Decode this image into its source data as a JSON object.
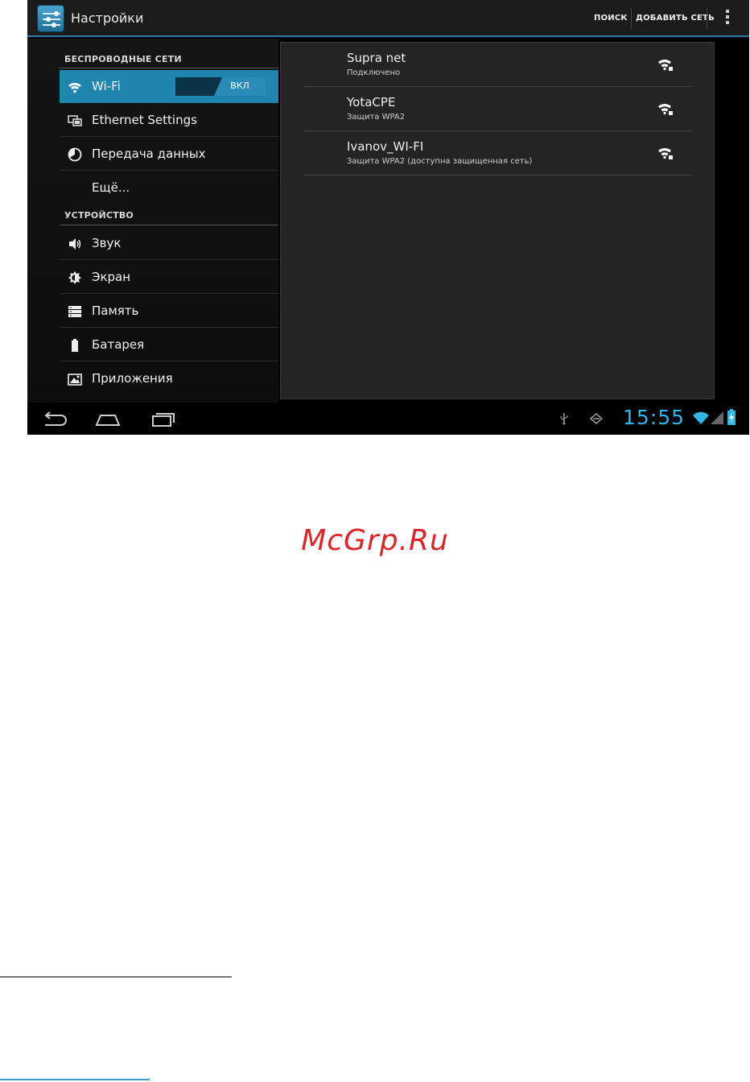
{
  "actionbar": {
    "title": "Настройки",
    "search_label": "ПОИСК",
    "add_network_label": "ДОБАВИТЬ СЕТЬ",
    "accent_color": "#33b5e5"
  },
  "sidebar": {
    "section_wireless": "БЕСПРОВОДНЫЕ СЕТИ",
    "section_device": "УСТРОЙСТВО",
    "items": [
      {
        "label": "Wi-Fi",
        "icon": "wifi-icon",
        "selected": true
      },
      {
        "label": "Ethernet Settings",
        "icon": "ethernet-icon"
      },
      {
        "label": "Передача данных",
        "icon": "data-usage-icon"
      },
      {
        "label": "Ещё...",
        "icon": ""
      },
      {
        "label": "Звук",
        "icon": "speaker-icon"
      },
      {
        "label": "Экран",
        "icon": "brightness-icon"
      },
      {
        "label": "Память",
        "icon": "storage-icon"
      },
      {
        "label": "Батарея",
        "icon": "battery-icon"
      },
      {
        "label": "Приложения",
        "icon": "apps-icon"
      }
    ],
    "wifi_toggle": {
      "state_label": "ВКЛ",
      "on": true
    }
  },
  "networks": [
    {
      "name": "Supra net",
      "status": "Подключено"
    },
    {
      "name": "YotaCPE",
      "status": "Защита WPA2"
    },
    {
      "name": "Ivanov_WI-FI",
      "status": "Защита WPA2 (доступна защищенная сеть)"
    }
  ],
  "statusbar": {
    "time": "15:55"
  },
  "page": {
    "watermark": "McGrp.Ru",
    "watermark_color": "#d9262a"
  }
}
